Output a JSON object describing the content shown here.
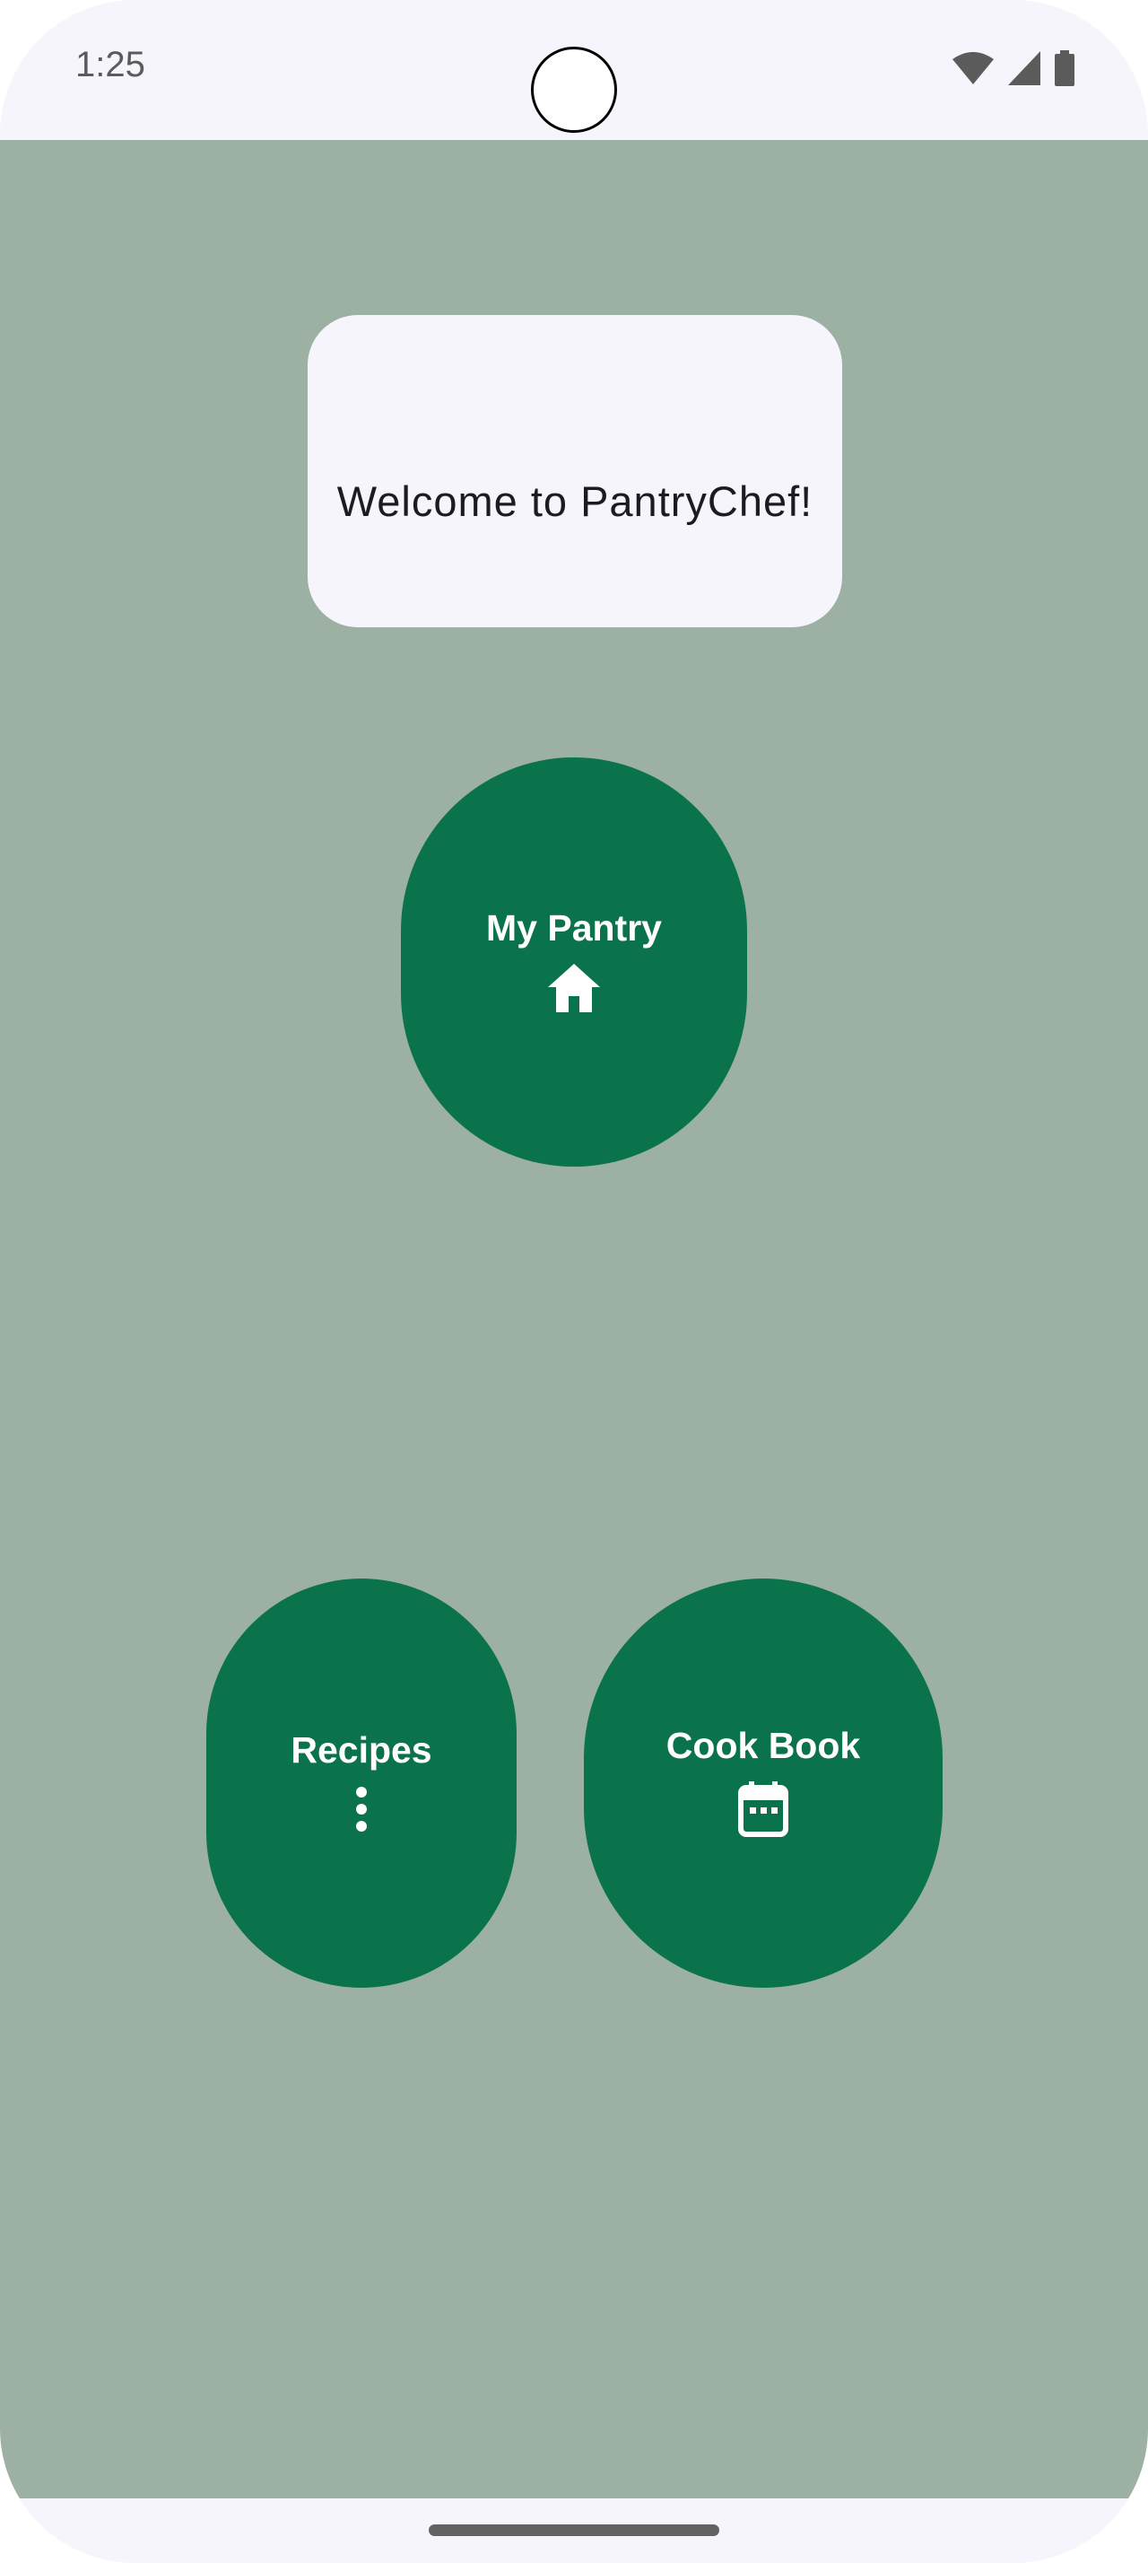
{
  "status_bar": {
    "time": "1:25",
    "icons": [
      "wifi-icon",
      "cellular-signal-icon",
      "battery-icon"
    ]
  },
  "welcome": {
    "text": "Welcome to PantryChef!"
  },
  "buttons": {
    "my_pantry": {
      "label": "My Pantry",
      "icon": "home-icon"
    },
    "recipes": {
      "label": "Recipes",
      "icon": "more-vertical-icon"
    },
    "cook_book": {
      "label": "Cook Book",
      "icon": "calendar-icon"
    }
  },
  "colors": {
    "background": "#9cb0a3",
    "button": "#0a734b",
    "card": "#f6f5fb",
    "system_bar": "#f6f5fb"
  }
}
